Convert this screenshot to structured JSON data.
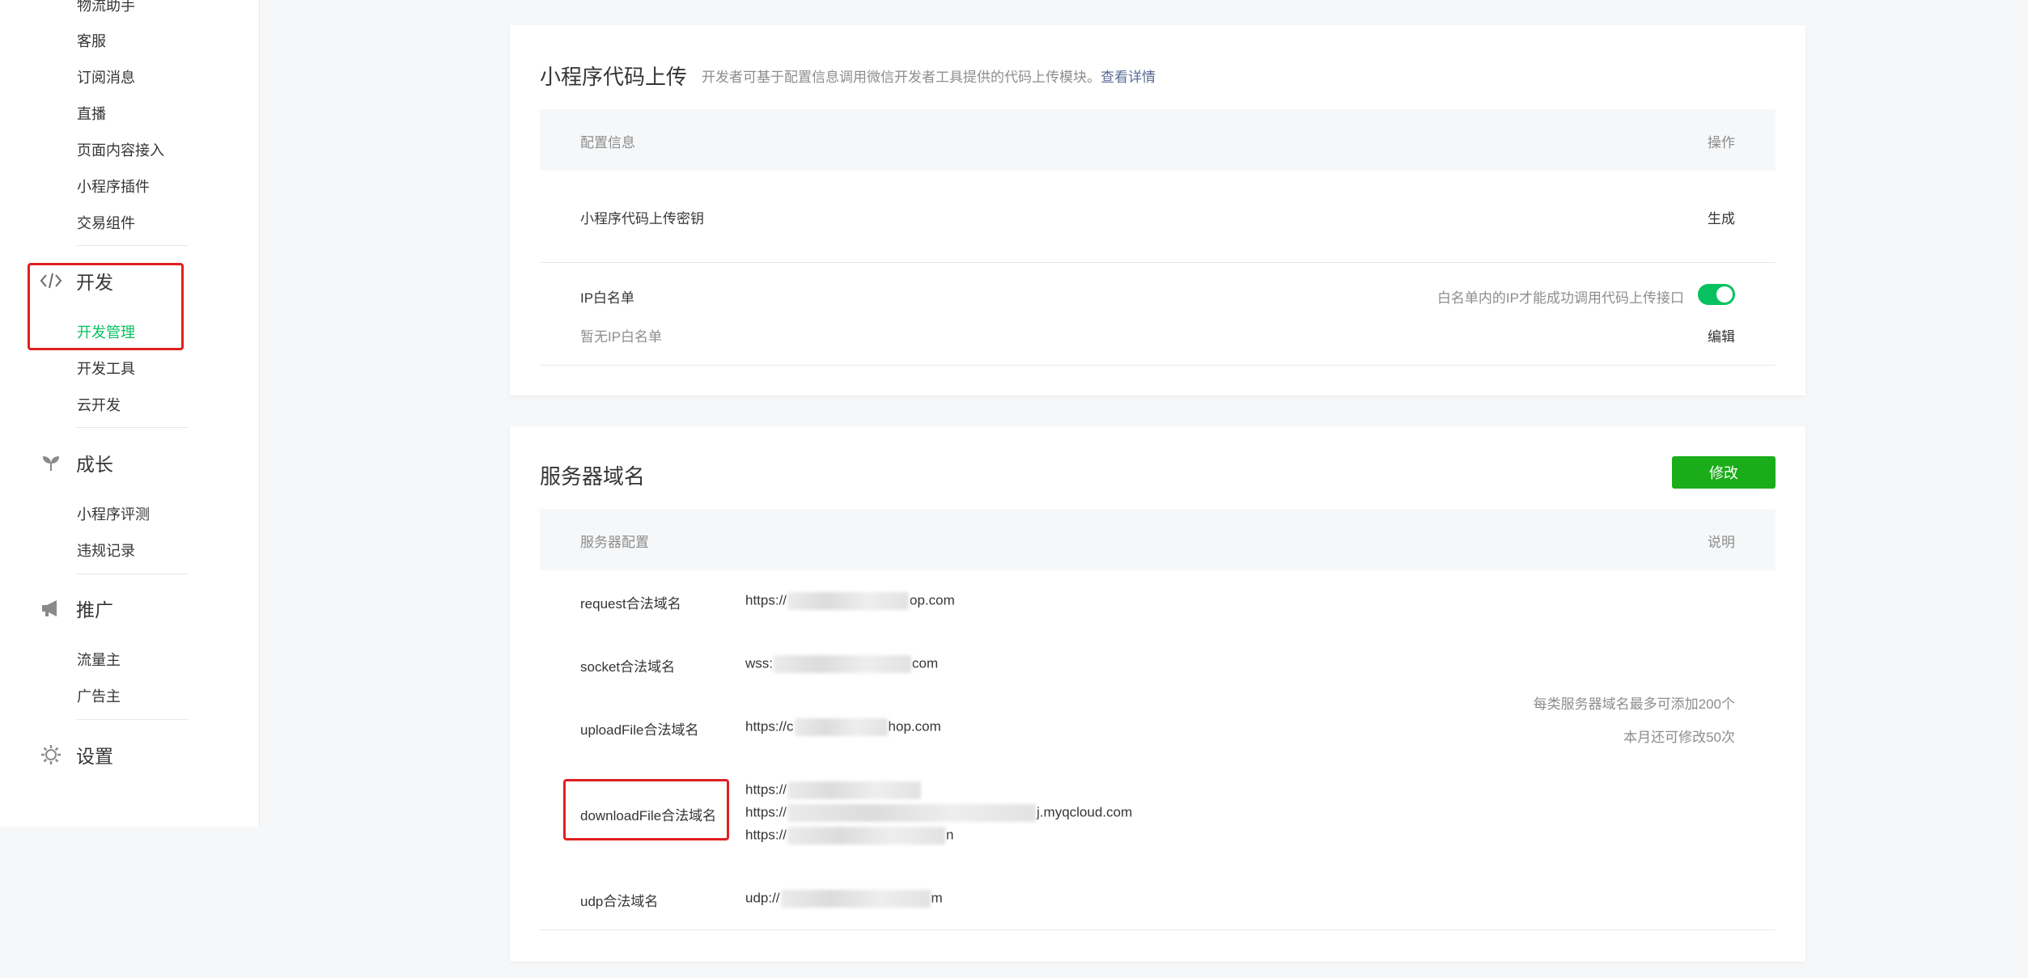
{
  "sidebar": {
    "items_top": [
      "物流助手",
      "客服",
      "订阅消息",
      "直播",
      "页面内容接入",
      "小程序插件",
      "交易组件"
    ],
    "groups": [
      {
        "label": "开发",
        "icon": "code-icon",
        "items": [
          "开发管理",
          "开发工具",
          "云开发"
        ]
      },
      {
        "label": "成长",
        "icon": "sprout-icon",
        "items": [
          "小程序评测",
          "违规记录"
        ]
      },
      {
        "label": "推广",
        "icon": "megaphone-icon",
        "items": [
          "流量主",
          "广告主"
        ]
      },
      {
        "label": "设置",
        "icon": "gear-icon",
        "items": []
      }
    ],
    "active_item": "开发管理",
    "active_color": "#07c160"
  },
  "upload_card": {
    "title": "小程序代码上传",
    "desc": "开发者可基于配置信息调用微信开发者工具提供的代码上传模块。",
    "desc_link": "查看详情",
    "table_head": {
      "left": "配置信息",
      "right": "操作"
    },
    "key_row": {
      "label": "小程序代码上传密钥",
      "action": "生成"
    },
    "ip_row": {
      "label": "IP白名单",
      "sub": "暂无IP白名单",
      "hint": "白名单内的IP才能成功调用代码上传接口",
      "toggle_on": true,
      "action": "编辑"
    }
  },
  "domain_card": {
    "title": "服务器域名",
    "edit_button": "修改",
    "table_head": {
      "left": "服务器配置",
      "right": "说明"
    },
    "rows": [
      {
        "label": "request合法域名",
        "prefix": "https://",
        "suffix": "op.com"
      },
      {
        "label": "socket合法域名",
        "prefix": "wss:",
        "suffix": "com"
      },
      {
        "label": "uploadFile合法域名",
        "prefix": "https://c",
        "suffix": "hop.com"
      },
      {
        "label": "downloadFile合法域名",
        "lines": [
          {
            "prefix": "https://",
            "suffix": ""
          },
          {
            "prefix": "https://",
            "suffix": "j.myqcloud.com"
          },
          {
            "prefix": "https://",
            "suffix": "n"
          }
        ]
      },
      {
        "label": "udp合法域名",
        "prefix": "udp://",
        "suffix": "m"
      }
    ],
    "notes": [
      "每类服务器域名最多可添加200个",
      "本月还可修改50次"
    ]
  },
  "colors": {
    "accent_green": "#07c160",
    "button_green": "#1aad19",
    "link_blue": "#576b95",
    "highlight_red": "#e02020"
  }
}
